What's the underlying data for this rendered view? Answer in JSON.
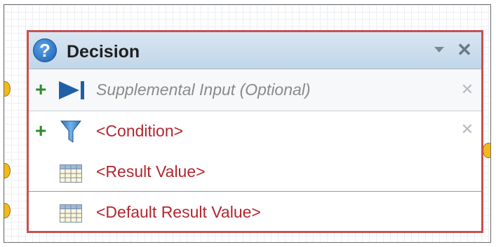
{
  "node": {
    "title": "Decision",
    "help_icon_char": "?",
    "close_char": "✕"
  },
  "rows": [
    {
      "label": "Supplemental Input (Optional)",
      "plus": "+",
      "close": "✕",
      "icon": "skip-forward-icon"
    },
    {
      "label": "<Condition>",
      "plus": "+",
      "close": "✕",
      "icon": "funnel-icon"
    },
    {
      "label": "<Result Value>",
      "icon": "table-icon"
    },
    {
      "label": "<Default Result Value>",
      "icon": "table-icon"
    }
  ],
  "colors": {
    "node_border": "#c95050",
    "header_bg": "#c1d6e8",
    "label_red": "#b3262f",
    "plus_green": "#2f8a2f",
    "port_orange": "#f2b91c"
  }
}
